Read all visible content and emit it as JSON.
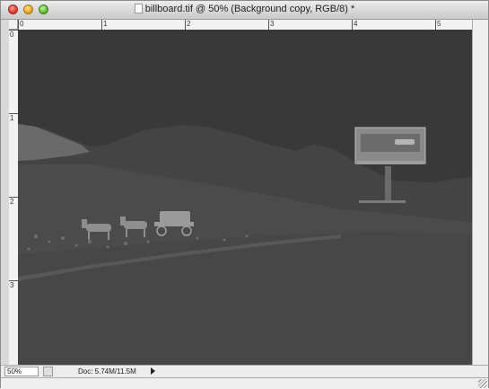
{
  "window": {
    "title": "billboard.tif @ 50% (Background copy, RGB/8) *"
  },
  "rulers": {
    "top_labels": [
      "0",
      "1",
      "2",
      "3",
      "4",
      "5"
    ],
    "left_labels": [
      "0",
      "1",
      "2",
      "3"
    ]
  },
  "status": {
    "zoom": "50%",
    "doc_info": "Doc: 5.74M/11.5M"
  },
  "colors": {
    "sky": "#3b3b3b",
    "ground": "#4a4a4a",
    "chrome": "#d9d9d9"
  },
  "icons": {
    "close": "close-icon",
    "minimize": "minimize-icon",
    "zoom": "zoom-icon",
    "document": "document-icon",
    "status_menu": "arrow-right-icon"
  }
}
